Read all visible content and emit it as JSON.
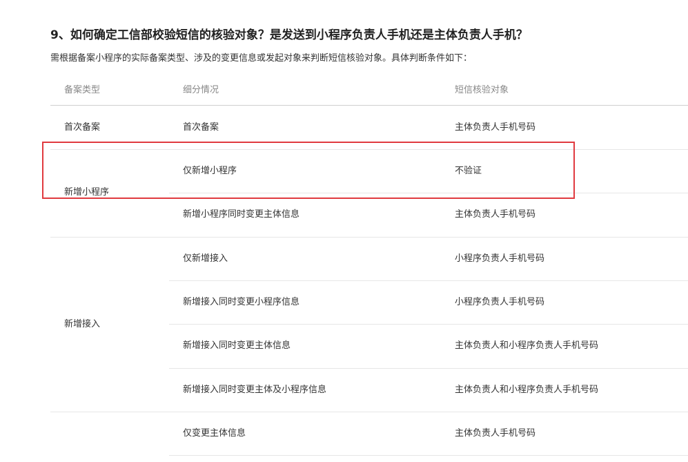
{
  "heading": "9、如何确定工信部校验短信的核验对象？是发送到小程序负责人手机还是主体负责人手机？",
  "intro": "需根据备案小程序的实际备案类型、涉及的变更信息或发起对象来判断短信核验对象。具体判断条件如下：",
  "table": {
    "headers": [
      "备案类型",
      "细分情况",
      "短信核验对象"
    ],
    "groups": [
      {
        "type": "首次备案",
        "rows": [
          {
            "case": "首次备案",
            "target": "主体负责人手机号码"
          }
        ]
      },
      {
        "type": "新增小程序",
        "rows": [
          {
            "case": "仅新增小程序",
            "target": "不验证"
          },
          {
            "case": "新增小程序同时变更主体信息",
            "target": "主体负责人手机号码"
          }
        ]
      },
      {
        "type": "新增接入",
        "rows": [
          {
            "case": "仅新增接入",
            "target": "小程序负责人手机号码"
          },
          {
            "case": "新增接入同时变更小程序信息",
            "target": "小程序负责人手机号码"
          },
          {
            "case": "新增接入同时变更主体信息",
            "target": "主体负责人和小程序负责人手机号码"
          },
          {
            "case": "新增接入同时变更主体及小程序信息",
            "target": "主体负责人和小程序负责人手机号码"
          }
        ]
      },
      {
        "type": "",
        "rows": [
          {
            "case": "仅变更主体信息",
            "target": "主体负责人手机号码"
          }
        ]
      }
    ]
  },
  "colors": {
    "highlight": "#e0393e",
    "header_text": "#888888",
    "divider": "#e6e6e6"
  }
}
